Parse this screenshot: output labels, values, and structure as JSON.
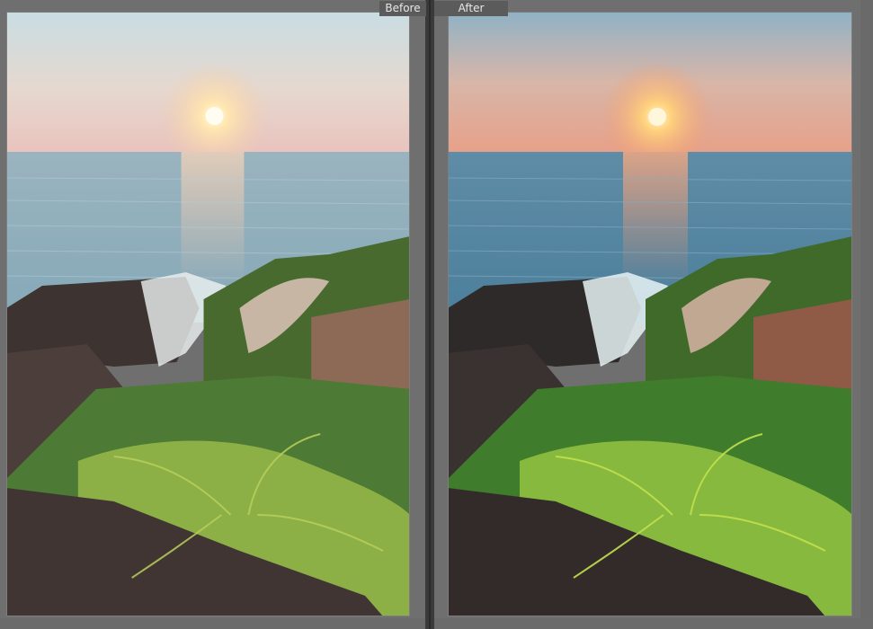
{
  "view": {
    "mode": "before-after",
    "before_label": "Before",
    "after_label": "After"
  },
  "colors": {
    "background": "#545454",
    "tab": "#5b5b5b",
    "tab_text": "#e8e8e8"
  }
}
